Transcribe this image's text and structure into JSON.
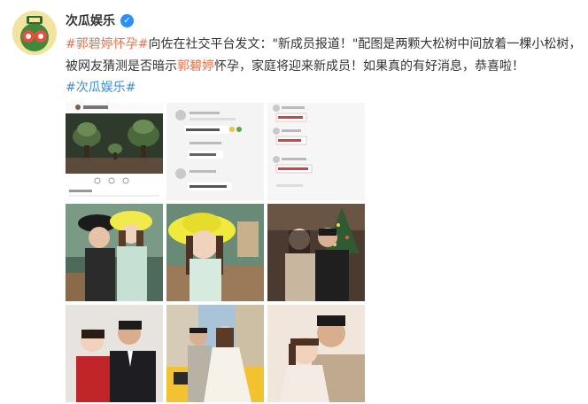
{
  "post": {
    "author": "次瓜娱乐",
    "verified_icon": "verified-badge-icon",
    "hashtag_prefix": "#",
    "hashtag_name": "郭碧婷怀孕",
    "hashtag_suffix": "#",
    "text_part1": "向佐在社交平台发文：\"新成员报道！\"配图是两颗大松树中间放着一棵小松树，被网友猜测是否暗示",
    "text_highlight": "郭碧婷",
    "text_part2": "怀孕，家庭将迎来新成员！如果真的有好消息，恭喜啦！",
    "source_tag": "#次瓜娱乐#"
  },
  "images": [
    {
      "label": "instagram-screenshot"
    },
    {
      "label": "comments-screenshot"
    },
    {
      "label": "comments-screenshot-2"
    },
    {
      "label": "photo-yellow-hat-couple"
    },
    {
      "label": "photo-yellow-hat-closeup"
    },
    {
      "label": "photo-christmas-tree"
    },
    {
      "label": "photo-red-dress-couple"
    },
    {
      "label": "photo-wedding-yellow-car"
    },
    {
      "label": "photo-wedding-portrait"
    }
  ],
  "colors": {
    "hashtag": "#eb7350",
    "link_blue": "#3a8cde",
    "verified": "#2c8ef6"
  }
}
